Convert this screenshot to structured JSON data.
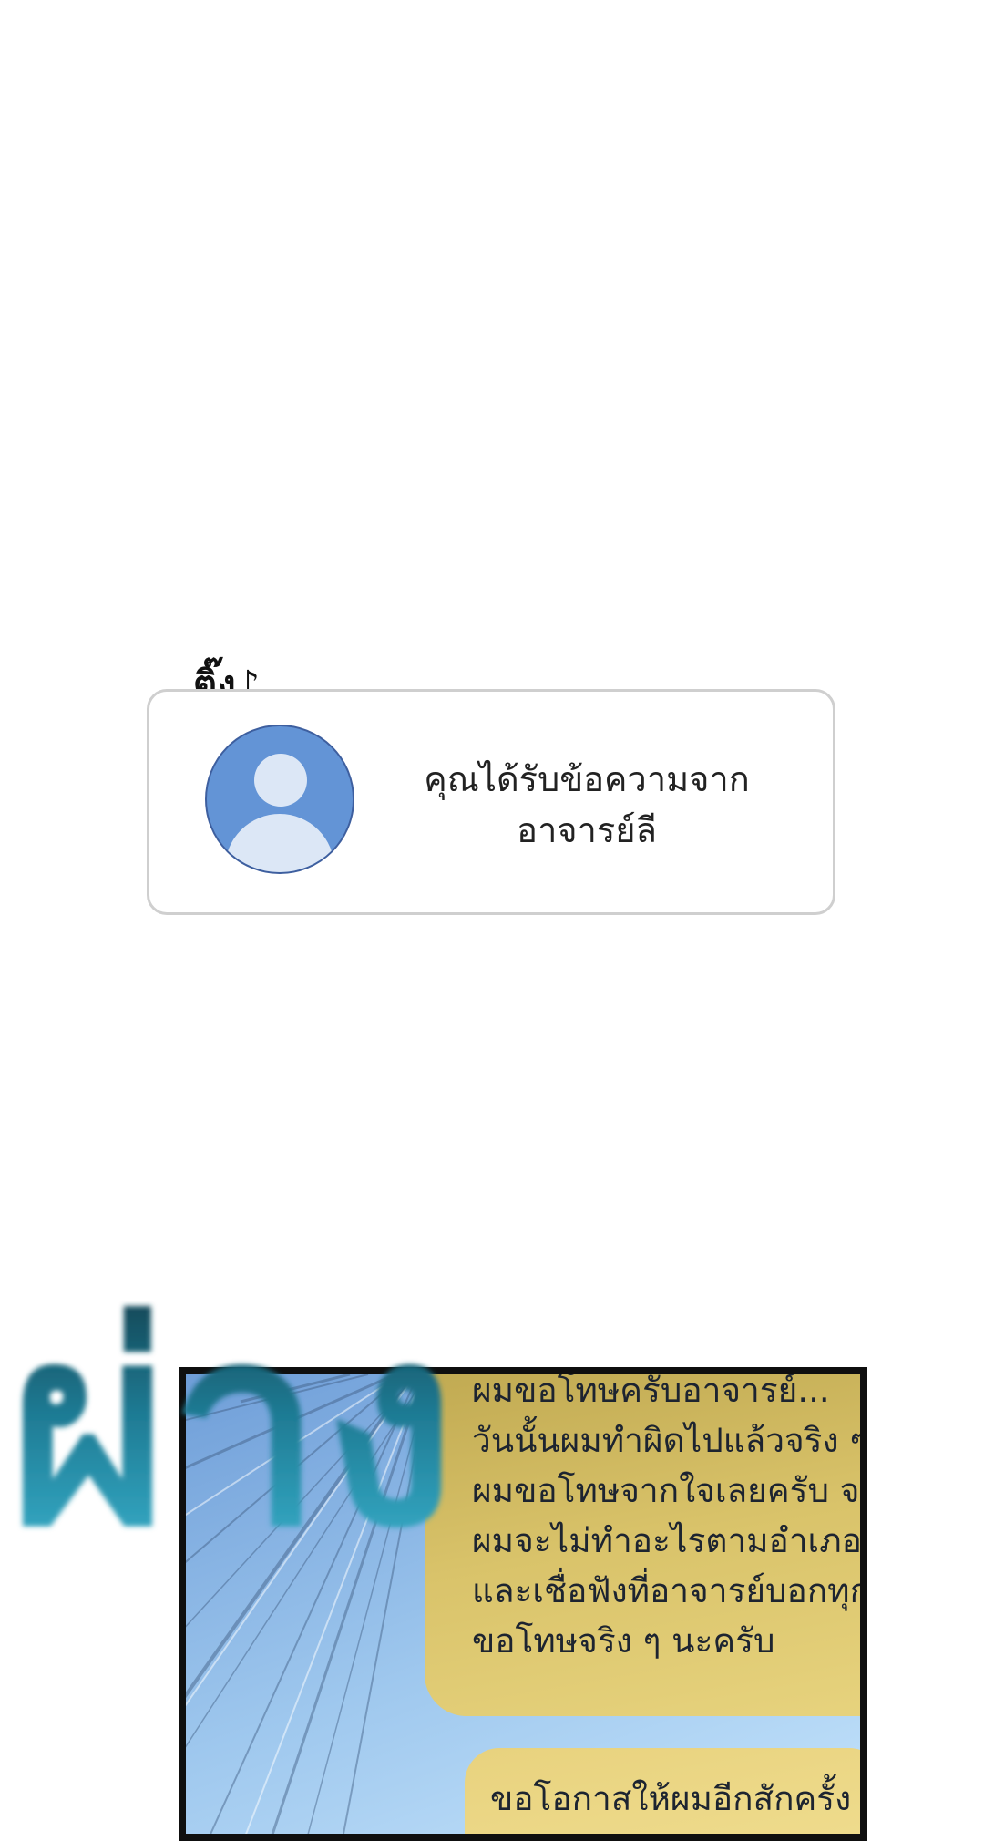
{
  "sfx_ting": "ติ๊ง♪",
  "notification": {
    "lines": [
      "คุณได้รับข้อความจาก",
      "อาจารย์ลี"
    ],
    "avatar_icon": "default-user-avatar",
    "avatar_color": "#6394d6"
  },
  "chat_panel": {
    "message1_lines": [
      "ผมขอโทษครับอาจารย์...",
      "วันนั้นผมทำผิดไปแล้วจริง ๆ",
      "ผมขอโทษจากใจเลยครับ จา",
      "ผมจะไม่ทำอะไรตามอำเภอใ",
      "และเชื่อฟังที่อาจารย์บอกทุก",
      "ขอโทษจริง ๆ นะครับ"
    ],
    "message2_lines": [
      "ขอโอกาสให้ผมอีกสักครั้ง"
    ],
    "bubble_color": "#d9c36a"
  },
  "sfx_big": "ผ่าง",
  "colors": {
    "sfx_dark": "#0e3b48",
    "sfx_light": "#3cb8d4"
  }
}
